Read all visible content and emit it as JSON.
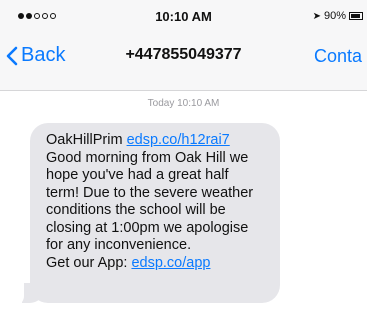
{
  "status_bar": {
    "carrier": "",
    "time": "10:10 AM",
    "battery_text": "90%"
  },
  "nav": {
    "back_label": "Back",
    "title": "+447855049377",
    "contact_label": "Conta"
  },
  "thread": {
    "timestamp": "Today 10:10 AM",
    "message": {
      "sender_prefix": "OakHillPrim ",
      "link1": "edsp.co/h12rai7",
      "line2": "Good morning from Oak Hill we",
      "line3": "hope you've had a great half",
      "line4": "term! Due to the severe weather",
      "line5": "conditions the school will be",
      "line6": "closing at 1:00pm we apologise",
      "line7": "for any inconvenience.",
      "app_prefix": "Get our App: ",
      "link2": "edsp.co/app"
    }
  },
  "colors": {
    "accent": "#0a7aff",
    "bubble": "#e6e6ea",
    "nav_background": "#f7f7f8"
  }
}
